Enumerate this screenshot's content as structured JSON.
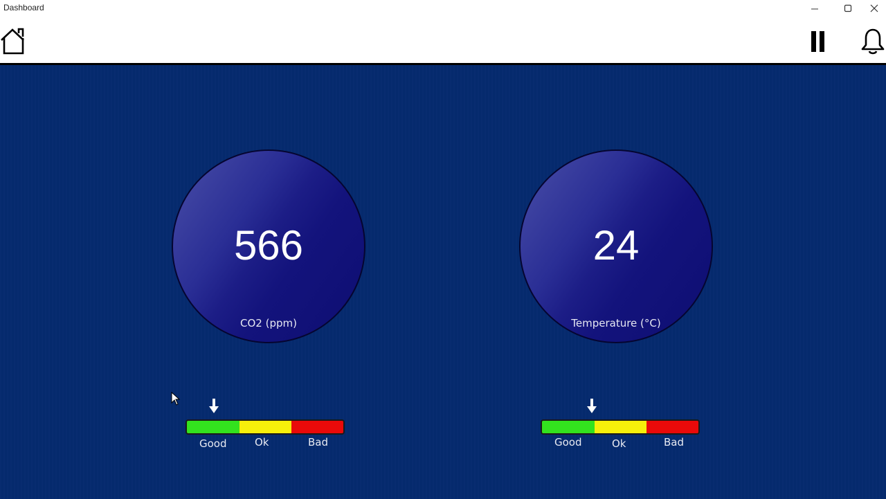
{
  "window": {
    "title": "Dashboard",
    "minimize_icon": "minimize-icon",
    "maximize_icon": "maximize-icon",
    "close_icon": "close-icon"
  },
  "toolbar": {
    "home_icon": "home-icon",
    "pause_icon": "pause-icon",
    "bell_icon": "bell-icon"
  },
  "gauges": [
    {
      "value": "566",
      "label": "CO2 (ppm)",
      "scale": {
        "labels": [
          "Good",
          "Ok",
          "Bad"
        ],
        "indicator_fraction": 0.18
      }
    },
    {
      "value": "24",
      "label": "Temperature (°C)",
      "scale": {
        "labels": [
          "Good",
          "Ok",
          "Bad"
        ],
        "indicator_fraction": 0.32
      }
    }
  ],
  "colors": {
    "background": "#052a6e",
    "good": "#33e21e",
    "ok": "#f6ef0b",
    "bad": "#e90a0a"
  }
}
